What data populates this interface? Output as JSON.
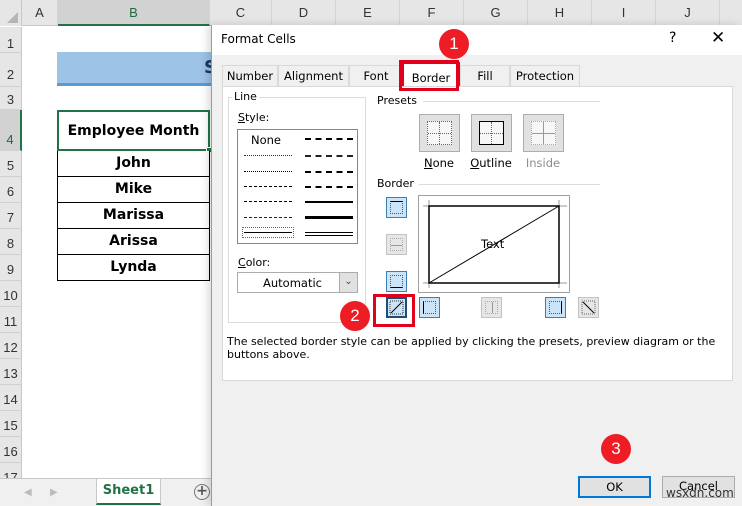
{
  "spreadsheet": {
    "columns": [
      "A",
      "B",
      "C",
      "D",
      "E",
      "F",
      "G",
      "H",
      "I",
      "J"
    ],
    "selected_column": "B",
    "rows": [
      "1",
      "2",
      "3",
      "4",
      "5",
      "6",
      "7",
      "8",
      "9",
      "10",
      "11",
      "12",
      "13",
      "14",
      "15",
      "16",
      "17"
    ],
    "selected_row": "4",
    "title_partial": "S",
    "header_cell": "Employee Month",
    "names": [
      "John",
      "Mike",
      "Marissa",
      "Arissa",
      "Lynda"
    ],
    "sheet_tab": "Sheet1",
    "add_sheet_symbol": "+",
    "title_fill_color": "#9dc3e6",
    "accent_color": "#217346"
  },
  "dialog": {
    "title": "Format Cells",
    "help_symbol": "?",
    "close_symbol": "✕",
    "tabs": [
      {
        "label": "Number",
        "active": false
      },
      {
        "label": "Alignment",
        "active": false
      },
      {
        "label": "Font",
        "active": false
      },
      {
        "label": "Border",
        "active": true
      },
      {
        "label": "Fill",
        "active": false
      },
      {
        "label": "Protection",
        "active": false
      }
    ],
    "line_group": {
      "label": "Line",
      "style_label_first": "S",
      "style_label_rest": "tyle:",
      "style_none": "None",
      "color_label_first": "C",
      "color_label_rest": "olor:",
      "color_value": "Automatic"
    },
    "presets": {
      "label": "Presets",
      "items": [
        {
          "label_first": "N",
          "label_rest": "one",
          "enabled": true
        },
        {
          "label_first": "O",
          "label_rest": "utline",
          "enabled": true
        },
        {
          "label_first": "",
          "label_rest": "Inside",
          "enabled": false
        }
      ]
    },
    "border": {
      "label": "Border",
      "preview_text": "Text",
      "buttons": [
        {
          "name": "top-border",
          "state": "on"
        },
        {
          "name": "inside-horizontal-border",
          "state": "disabled"
        },
        {
          "name": "bottom-border",
          "state": "on"
        },
        {
          "name": "diagonal-up-border",
          "state": "selected"
        },
        {
          "name": "left-border",
          "state": "on"
        },
        {
          "name": "inside-vertical-border",
          "state": "disabled"
        },
        {
          "name": "right-border",
          "state": "on"
        },
        {
          "name": "diagonal-down-border",
          "state": "off"
        }
      ]
    },
    "description": "The selected border style can be applied by clicking the presets, preview diagram or the buttons above.",
    "ok_label": "OK",
    "cancel_label": "Cancel"
  },
  "annotations": {
    "markers": [
      "1",
      "2",
      "3"
    ],
    "marker_color": "#ee1c25"
  },
  "watermark": "wsxdn.com"
}
